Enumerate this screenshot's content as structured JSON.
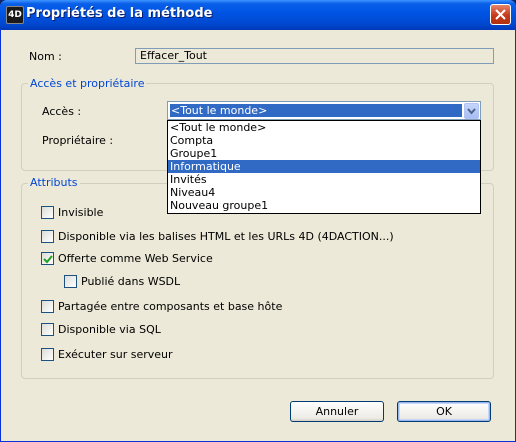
{
  "window": {
    "title": "Propriétés de la méthode",
    "icon_text": "4D"
  },
  "name_row": {
    "label": "Nom :",
    "value": "Effacer_Tout"
  },
  "access_group": {
    "title": "Accès et propriétaire",
    "access_label": "Accès :",
    "access_selected": "<Tout le monde>",
    "owner_label": "Propriétaire :",
    "dropdown_options": [
      "<Tout le monde>",
      "Compta",
      "Groupe1",
      "Informatique",
      "Invités",
      "Niveau4",
      "Nouveau groupe1"
    ],
    "highlighted_option": "Informatique"
  },
  "attributes_group": {
    "title": "Attributs",
    "invisible": {
      "label": "Invisible",
      "checked": false
    },
    "html_urls": {
      "label": "Disponible via les balises HTML et les URLs 4D (4DACTION...)",
      "checked": false
    },
    "web_service": {
      "label": "Offerte comme Web Service",
      "checked": true
    },
    "wsdl": {
      "label": "Publié dans WSDL",
      "checked": false
    },
    "shared": {
      "label": "Partagée entre composants et base hôte",
      "checked": false
    },
    "sql": {
      "label": "Disponible via SQL",
      "checked": false
    },
    "server": {
      "label": "Exécuter sur serveur",
      "checked": false
    }
  },
  "buttons": {
    "cancel": "Annuler",
    "ok": "OK"
  }
}
